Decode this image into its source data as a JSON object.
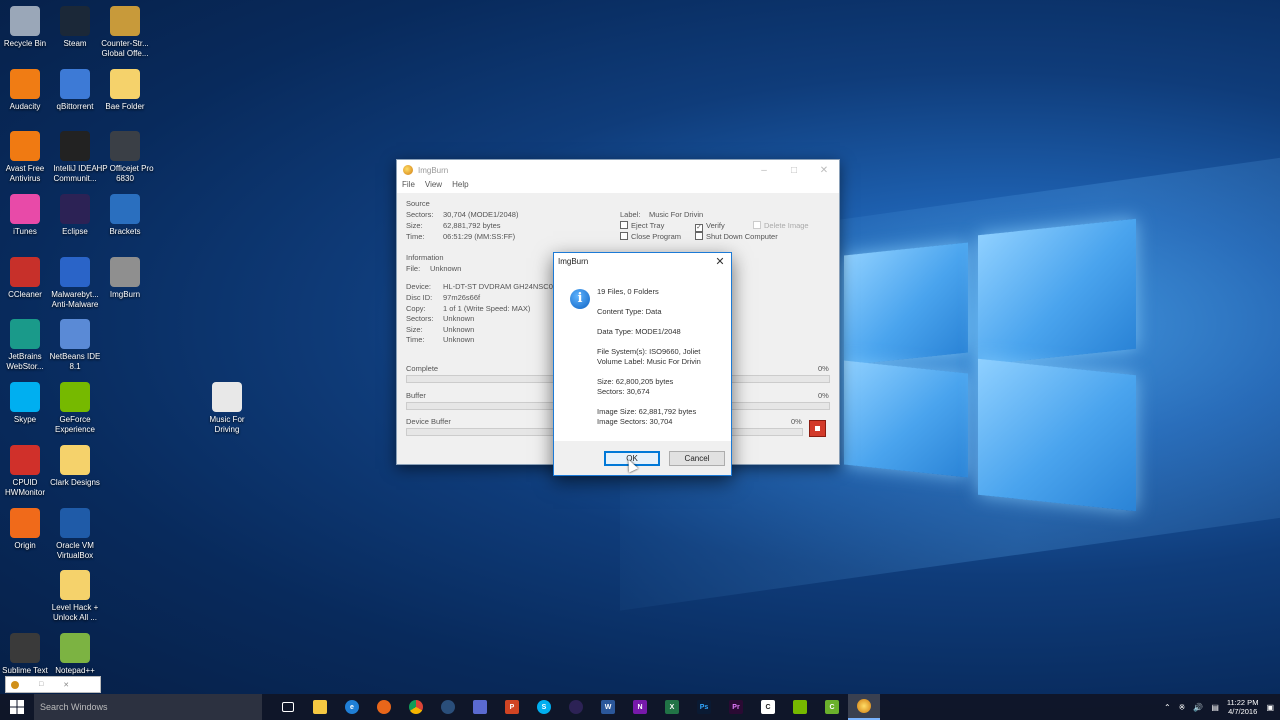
{
  "desktop_icons": [
    {
      "label": "Recycle Bin",
      "icon": "recycle-bin-icon",
      "color": "#9aa7b8"
    },
    {
      "label": "Steam",
      "icon": "steam-icon",
      "color": "#1b2838"
    },
    {
      "label": "Counter-Str... Global Offe...",
      "icon": "csgo-icon",
      "color": "#c89a3a"
    },
    {
      "label": "Audacity",
      "icon": "audacity-icon",
      "color": "#f07c14"
    },
    {
      "label": "qBittorrent",
      "icon": "qbittorrent-icon",
      "color": "#3d7ad6"
    },
    {
      "label": "Bae Folder",
      "icon": "folder-icon",
      "color": "#f5d26b"
    },
    {
      "label": "Avast Free Antivirus",
      "icon": "avast-icon",
      "color": "#f07a12"
    },
    {
      "label": "IntelliJ IDEA Communit...",
      "icon": "intellij-icon",
      "color": "#222222"
    },
    {
      "label": "HP Officejet Pro 6830",
      "icon": "printer-icon",
      "color": "#3a3f46"
    },
    {
      "label": "iTunes",
      "icon": "itunes-icon",
      "color": "#e84aa8"
    },
    {
      "label": "Eclipse",
      "icon": "eclipse-icon",
      "color": "#2c2255"
    },
    {
      "label": "Brackets",
      "icon": "brackets-icon",
      "color": "#2a6fbf"
    },
    {
      "label": "CCleaner",
      "icon": "ccleaner-icon",
      "color": "#c7302a"
    },
    {
      "label": "Malwarebyt... Anti-Malware",
      "icon": "malwarebytes-icon",
      "color": "#2a64c8"
    },
    {
      "label": "ImgBurn",
      "icon": "imgburn-icon",
      "color": "#8f8f8f"
    },
    {
      "label": "JetBrains WebStor...",
      "icon": "webstorm-icon",
      "color": "#1a9a8a"
    },
    {
      "label": "NetBeans IDE 8.1",
      "icon": "netbeans-icon",
      "color": "#5a8ad6"
    },
    {
      "label": "Skype",
      "icon": "skype-icon",
      "color": "#00aff0"
    },
    {
      "label": "GeForce Experience",
      "icon": "geforce-icon",
      "color": "#76b900"
    },
    {
      "label": "Music For Driving",
      "icon": "music-file-icon",
      "color": "#e8e8e8"
    },
    {
      "label": "CPUID HWMonitor",
      "icon": "hwmonitor-icon",
      "color": "#d0302a"
    },
    {
      "label": "Clark Designs",
      "icon": "folder-icon",
      "color": "#f5d26b"
    },
    {
      "label": "Origin",
      "icon": "origin-icon",
      "color": "#f06a1a"
    },
    {
      "label": "Oracle VM VirtualBox",
      "icon": "virtualbox-icon",
      "color": "#1f5ba8"
    },
    {
      "label": "Level Hack + Unlock All ...",
      "icon": "folder-icon",
      "color": "#f5d26b"
    },
    {
      "label": "Sublime Text",
      "icon": "sublime-icon",
      "color": "#3a3a3a"
    },
    {
      "label": "Notepad++",
      "icon": "notepadpp-icon",
      "color": "#7cb342"
    }
  ],
  "main_window": {
    "title": "ImgBurn",
    "menu": [
      "File",
      "View",
      "Help"
    ],
    "source_heading": "Source",
    "sectors_label": "Sectors:",
    "sectors_value": "30,704 (MODE1/2048)",
    "size_label": "Size:",
    "size_value": "62,881,792 bytes",
    "time_label": "Time:",
    "time_value": "06:51:29 (MM:SS:FF)",
    "volume_label": "Label:",
    "volume_value": "Music For Drivin",
    "eject_tray": "Eject Tray",
    "verify": "Verify",
    "delete_image": "Delete Image",
    "close_program": "Close Program",
    "shut_down": "Shut Down Computer",
    "info_heading": "Information",
    "file_label": "File:",
    "file_value": "Unknown",
    "device_label": "Device:",
    "device_value": "HL-DT-ST DVDRAM GH24NSC0",
    "discid_label": "Disc ID:",
    "discid_value": "97m26s66f",
    "copy_label": "Copy:",
    "copy_value": "1 of 1 (Write Speed: MAX)",
    "isectors_label": "Sectors:",
    "isectors_value": "Unknown",
    "isize_label": "Size:",
    "isize_value": "Unknown",
    "itime_label": "Time:",
    "itime_value": "Unknown",
    "complete_label": "Complete",
    "complete_pct": "0%",
    "buffer_label": "Buffer",
    "buffer_pct": "0%",
    "device_buffer_label": "Device Buffer",
    "device_buffer_pct": "0%"
  },
  "dialog": {
    "title": "ImgBurn",
    "lines": {
      "files": "19 Files, 0 Folders",
      "content_type": "Content Type: Data",
      "data_type": "Data Type: MODE1/2048",
      "file_systems": "File System(s): ISO9660, Joliet",
      "volume_label": "Volume Label: Music For Drivin",
      "size": "Size: 62,800,205 bytes",
      "sectors": "Sectors: 30,674",
      "image_size": "Image Size: 62,881,792 bytes",
      "image_sectors": "Image Sectors: 30,704"
    },
    "ok": "OK",
    "cancel": "Cancel"
  },
  "taskbar": {
    "search_placeholder": "Search Windows",
    "time": "11:22 PM",
    "date": "4/7/2016"
  }
}
